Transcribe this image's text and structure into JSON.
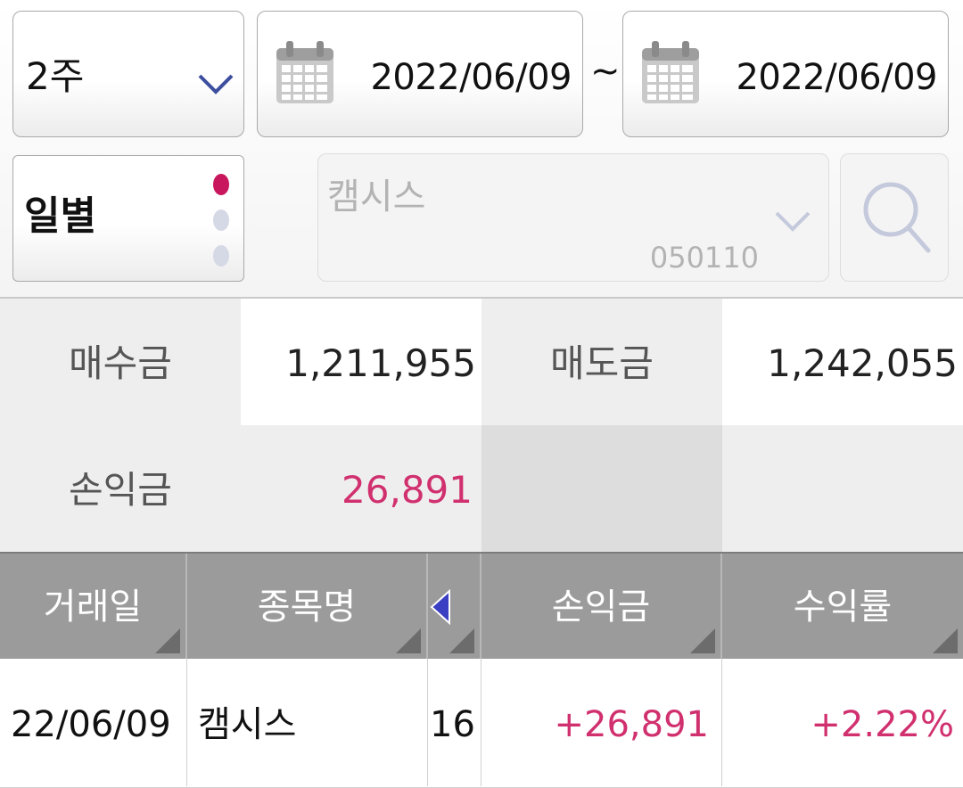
{
  "period": {
    "value": "2주"
  },
  "date_range": {
    "start": "2022/06/09",
    "separator": "~",
    "end": "2022/06/09"
  },
  "frequency": {
    "value": "일별"
  },
  "stock": {
    "name": "캠시스",
    "code": "050110"
  },
  "summary": {
    "buy_label": "매수금",
    "buy_value": "1,211,955",
    "sell_label": "매도금",
    "sell_value": "1,242,055",
    "pl_label": "손익금",
    "pl_value": "26,891"
  },
  "table": {
    "headers": [
      "거래일",
      "종목명",
      "손익금",
      "수익률"
    ],
    "rows": [
      {
        "date": "22/06/09",
        "name": "캠시스",
        "qty": "16",
        "pl": "+26,891",
        "rate": "+2.22%"
      }
    ]
  },
  "colors": {
    "accent_pink": "#d1306f",
    "header_gray": "#9b9b9b",
    "chevron_blue": "#3d4e9e"
  },
  "icons": [
    "chevron-down-icon",
    "calendar-icon",
    "search-icon",
    "triangle-left-icon",
    "sort-corner-icon"
  ]
}
